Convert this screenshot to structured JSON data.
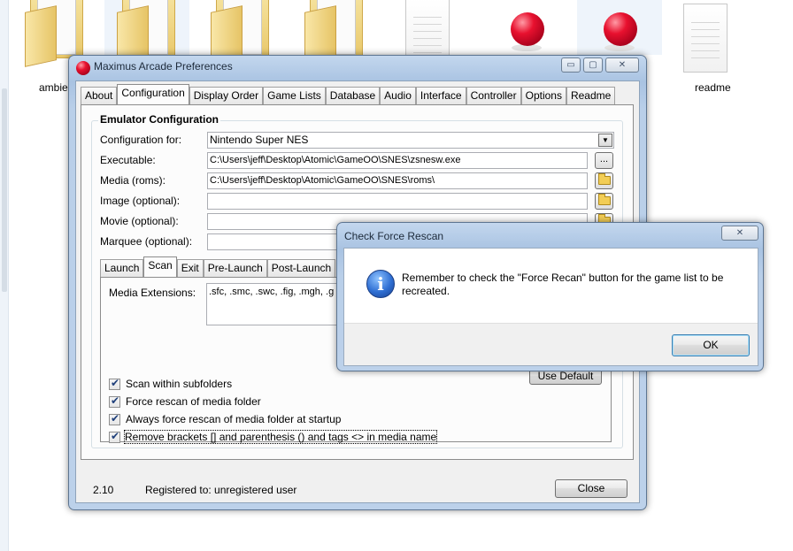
{
  "desktop": {
    "files": [
      {
        "label": "ambie"
      },
      {
        "label": ""
      },
      {
        "label": ""
      },
      {
        "label": ""
      },
      {
        "label": ""
      },
      {
        "label": ""
      },
      {
        "label": ""
      },
      {
        "label": "readme"
      }
    ]
  },
  "main_window": {
    "title": "Maximus Arcade Preferences",
    "controls": {
      "minimize": "▭",
      "maximize": "▢",
      "close": "✕"
    },
    "tabs": [
      {
        "label": "About"
      },
      {
        "label": "Configuration",
        "active": true
      },
      {
        "label": "Display Order"
      },
      {
        "label": "Game Lists"
      },
      {
        "label": "Database"
      },
      {
        "label": "Audio"
      },
      {
        "label": "Interface"
      },
      {
        "label": "Controller"
      },
      {
        "label": "Options"
      },
      {
        "label": "Readme"
      }
    ],
    "emulator": {
      "group_title": "Emulator Configuration",
      "config_label": "Configuration for:",
      "config_value": "Nintendo Super NES",
      "executable_label": "Executable:",
      "executable_value": "C:\\Users\\jeff\\Desktop\\Atomic\\GameOO\\SNES\\zsnesw.exe",
      "browse_label": "...",
      "media_label": "Media (roms):",
      "media_value": "C:\\Users\\jeff\\Desktop\\Atomic\\GameOO\\SNES\\roms\\",
      "image_label": "Image (optional):",
      "image_value": "",
      "movie_label": "Movie (optional):",
      "movie_value": "",
      "marquee_label": "Marquee (optional):",
      "marquee_value": ""
    },
    "subtabs": [
      {
        "label": "Launch"
      },
      {
        "label": "Scan",
        "active": true
      },
      {
        "label": "Exit"
      },
      {
        "label": "Pre-Launch"
      },
      {
        "label": "Post-Launch"
      }
    ],
    "scan": {
      "extensions_label": "Media Extensions:",
      "extensions_value": ".sfc, .smc, .swc, .fig, .mgh, .g",
      "use_default": "Use Default",
      "checkboxes": [
        {
          "label": "Scan within subfolders",
          "checked": true
        },
        {
          "label": "Force rescan of media folder",
          "checked": true
        },
        {
          "label": "Always force rescan of media folder at startup",
          "checked": true
        },
        {
          "label": "Remove brackets [] and parenthesis () and tags <> in media name",
          "checked": true
        }
      ]
    },
    "footer": {
      "version": "2.10",
      "registration": "Registered to: unregistered user",
      "close_label": "Close"
    }
  },
  "dialog": {
    "title": "Check Force Rescan",
    "close": "✕",
    "icon": "information-icon",
    "message": "Remember to check the \"Force Recan\" button for the game list to be recreated.",
    "ok_label": "OK"
  }
}
